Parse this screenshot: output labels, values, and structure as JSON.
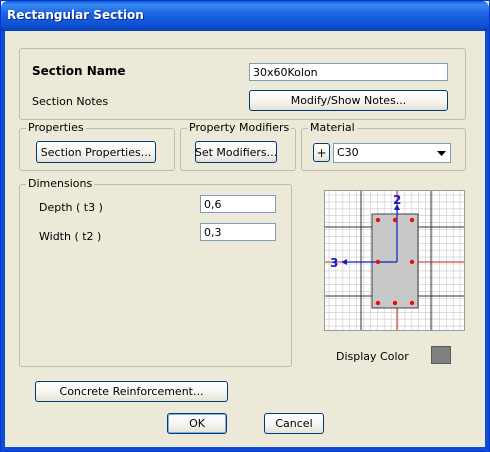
{
  "window": {
    "title": "Rectangular Section"
  },
  "section": {
    "name_label": "Section Name",
    "name_value": "30x60Kolon",
    "notes_label": "Section Notes",
    "notes_button": "Modify/Show Notes..."
  },
  "properties": {
    "group_label": "Properties",
    "button": "Section Properties..."
  },
  "modifiers": {
    "group_label": "Property Modifiers",
    "button": "Set Modifiers..."
  },
  "material": {
    "group_label": "Material",
    "plus": "+",
    "selected": "C30"
  },
  "dimensions": {
    "group_label": "Dimensions",
    "depth_label": "Depth  ( t3 )",
    "depth_value": "0,6",
    "width_label": "Width  ( t2 )",
    "width_value": "0,3"
  },
  "preview": {
    "axis2_label": "2",
    "axis3_label": "3",
    "rebar_count": 10
  },
  "display_color": {
    "label": "Display Color",
    "color": "#808080"
  },
  "concrete_reinforcement": {
    "button": "Concrete Reinforcement..."
  },
  "footer": {
    "ok": "OK",
    "cancel": "Cancel"
  }
}
